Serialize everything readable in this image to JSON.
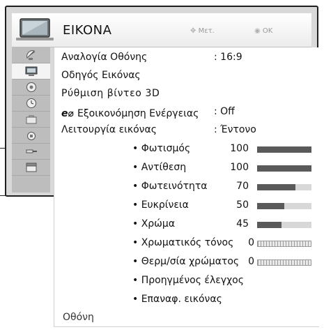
{
  "header": {
    "title": "EIKONA",
    "hint_move": "Μετ.",
    "hint_ok": "OK",
    "icon": "tv-picture-icon"
  },
  "sidebar": {
    "items": [
      {
        "icon": "satellite-dish-icon"
      },
      {
        "icon": "tv-picture-icon",
        "active": true
      },
      {
        "icon": "speaker-audio-icon"
      },
      {
        "icon": "clock-time-icon"
      },
      {
        "icon": "briefcase-options-icon"
      },
      {
        "icon": "lock-icon"
      },
      {
        "icon": "input-plug-icon"
      },
      {
        "icon": "clapper-media-icon"
      }
    ]
  },
  "menu": {
    "aspect_ratio": {
      "label": "Αναλογία Οθόνης",
      "value": ": 16:9"
    },
    "picture_wizard": {
      "label": "Οδηγός Εικόνας"
    },
    "video_3d": {
      "label": "Ρύθμιση βίντεο 3D"
    },
    "energy_saving": {
      "label": "Εξοικονόμηση Ενέργειας",
      "value": ": Off",
      "icon": "eco-energy-icon"
    },
    "picture_mode": {
      "label": "Λειτουργία εικόνας",
      "value": ": Έντονο"
    },
    "sub_items": [
      {
        "label": "• Φωτισμός",
        "value": "100",
        "level": 1.0,
        "type": "bar"
      },
      {
        "label": "• Αντίθεση",
        "value": "100",
        "level": 1.0,
        "type": "bar"
      },
      {
        "label": "• Φωτεινότητα",
        "value": "70",
        "level": 0.7,
        "type": "bar"
      },
      {
        "label": "• Ευκρίνεια",
        "value": "50",
        "level": 0.5,
        "type": "bar"
      },
      {
        "label": "• Χρώμα",
        "value": "45",
        "level": 0.45,
        "type": "bar"
      },
      {
        "label": "• Χρωματικός τόνος",
        "value": "0",
        "type": "center"
      },
      {
        "label": "• Θερμ/σία χρώματος",
        "value": "0",
        "type": "center"
      }
    ],
    "advanced": {
      "label": "• Προηγμένος έλεγχος"
    },
    "reset": {
      "label": "• Επαναφ. εικόνας"
    }
  },
  "footer": {
    "label": "Οθόνη"
  },
  "colors": {
    "frame": "#1e1e1e",
    "sidebar": "#bdbdbd",
    "bar_fill": "#5a5a5a",
    "bar_track": "#d8d8d8"
  }
}
